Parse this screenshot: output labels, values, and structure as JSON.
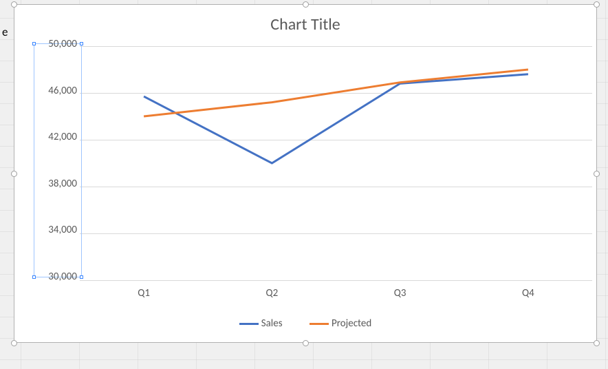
{
  "stray_cell_text": "e",
  "chart_data": {
    "type": "line",
    "title": "Chart Title",
    "categories": [
      "Q1",
      "Q2",
      "Q3",
      "Q4"
    ],
    "series": [
      {
        "name": "Sales",
        "color": "#4472C4",
        "values": [
          45700,
          40000,
          46800,
          47600
        ]
      },
      {
        "name": "Projected",
        "color": "#ED7D31",
        "values": [
          44000,
          45200,
          46900,
          48000
        ]
      }
    ],
    "ylim": [
      30000,
      50000
    ],
    "y_ticks": [
      30000,
      34000,
      38000,
      42000,
      46000,
      50000
    ],
    "y_tick_labels": [
      "30,000",
      "34,000",
      "38,000",
      "42,000",
      "46,000",
      "50,000"
    ],
    "xlabel": "",
    "ylabel": "",
    "grid": true,
    "legend_position": "bottom"
  }
}
